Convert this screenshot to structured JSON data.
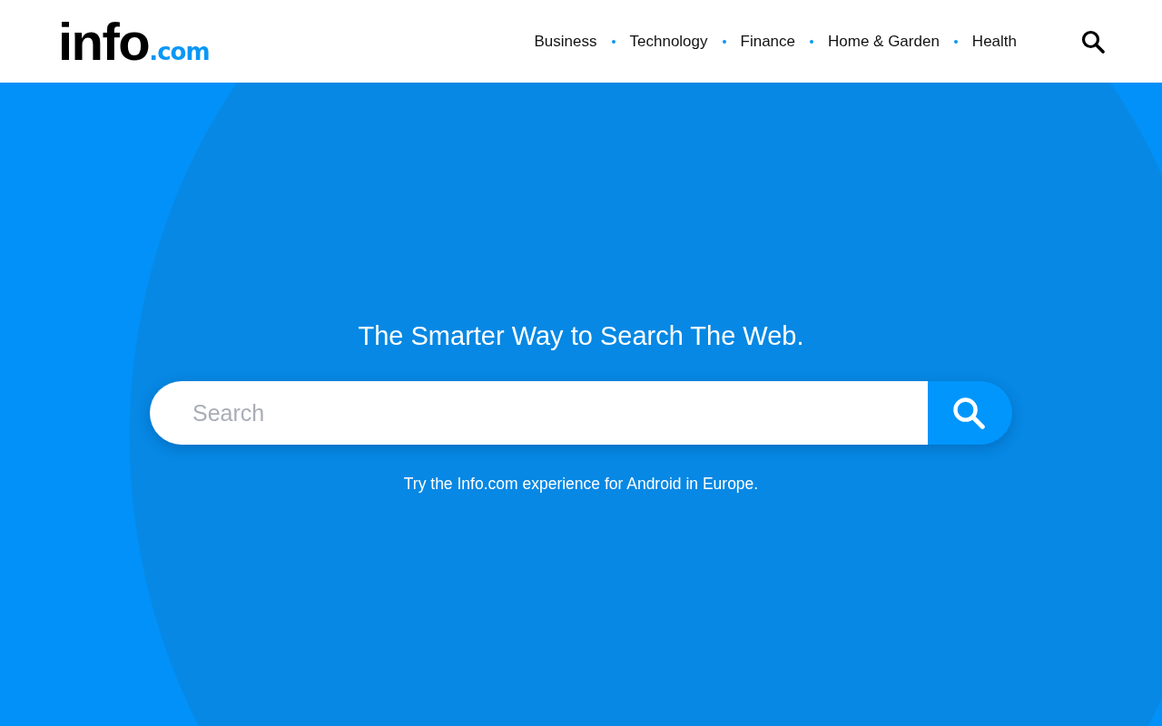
{
  "header": {
    "logo": {
      "name": "info",
      "suffix": ".com"
    },
    "nav": [
      "Business",
      "Technology",
      "Finance",
      "Home & Garden",
      "Health"
    ]
  },
  "hero": {
    "title": "The Smarter Way to Search The Web.",
    "search": {
      "placeholder": "Search"
    },
    "note": "Try the Info.com experience for Android in Europe."
  }
}
